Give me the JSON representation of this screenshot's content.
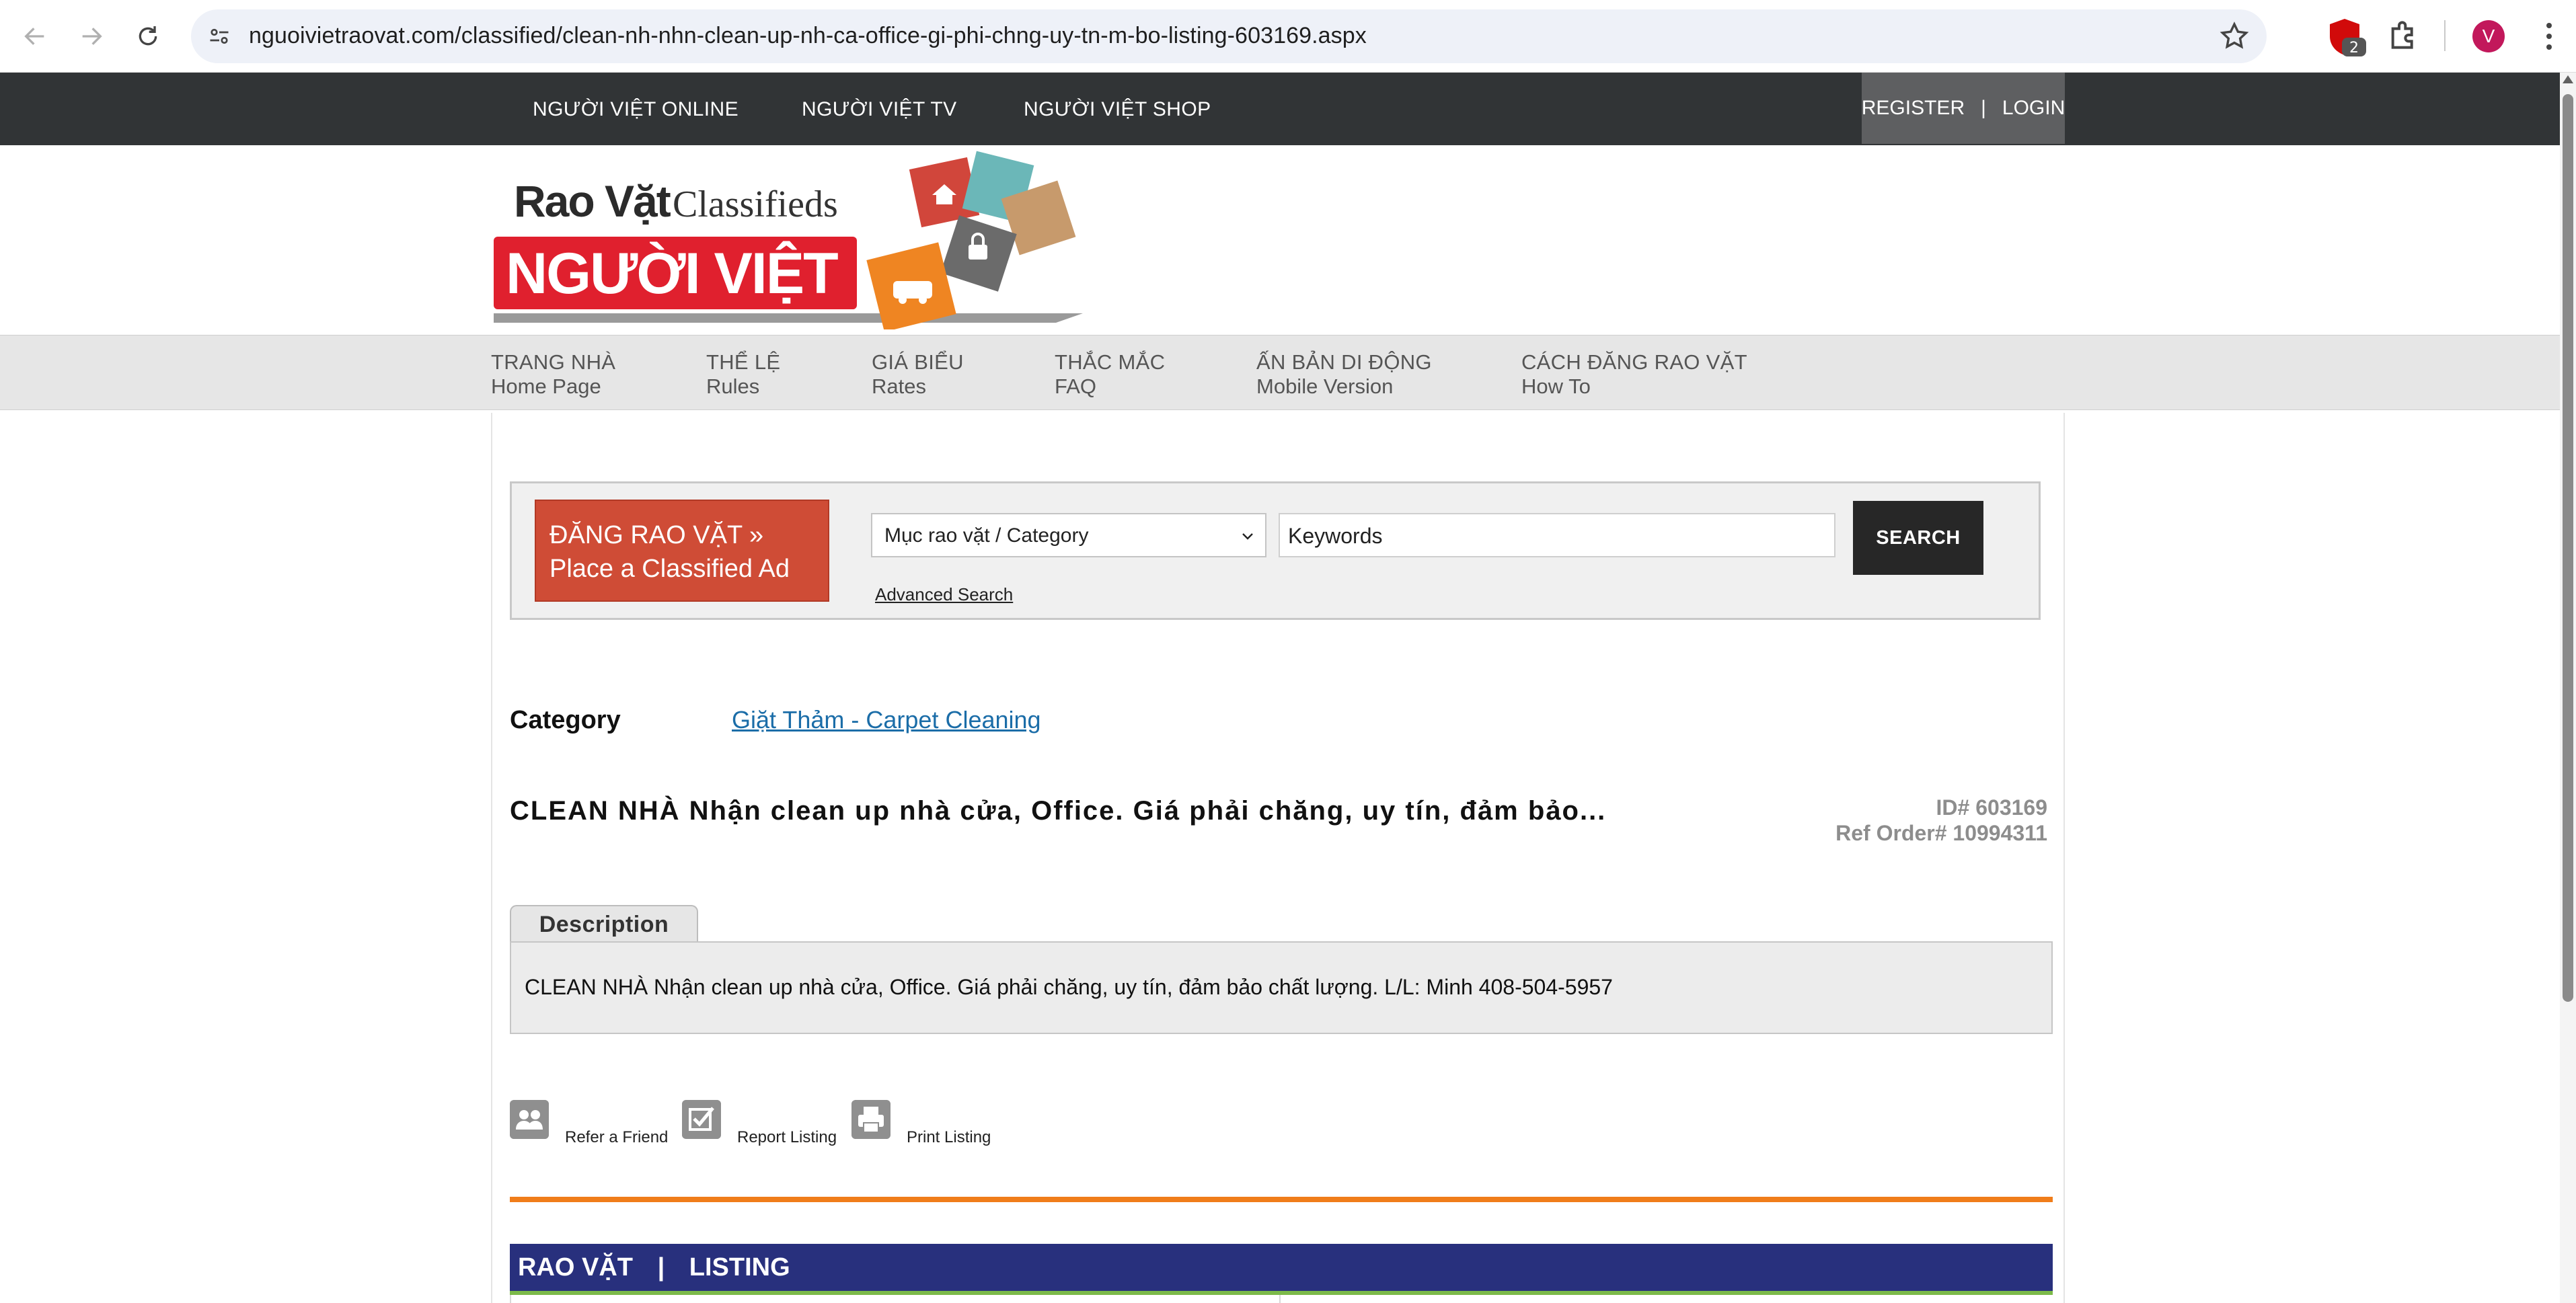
{
  "browser": {
    "url": "nguoivietraovat.com/classified/clean-nh-nhn-clean-up-nh-ca-office-gi-phi-chng-uy-tn-m-bo-listing-603169.aspx",
    "extension_badge": "2",
    "profile_initial": "V"
  },
  "topnav": {
    "links": [
      "NGƯỜI VIỆT ONLINE",
      "NGƯỜI VIỆT TV",
      "NGƯỜI VIỆT SHOP"
    ],
    "register": "REGISTER",
    "separator": "|",
    "login": "LOGIN"
  },
  "logo": {
    "line1_a": "Rao Vặt",
    "line1_b": "Classifieds",
    "line2": "NGƯỜI VIỆT"
  },
  "menu": [
    {
      "vn": "TRANG NHÀ",
      "en": "Home Page"
    },
    {
      "vn": "THỂ LỆ",
      "en": "Rules"
    },
    {
      "vn": "GIÁ BIỂU",
      "en": "Rates"
    },
    {
      "vn": "THẮC MẮC",
      "en": "FAQ"
    },
    {
      "vn": "ẤN BẢN DI ĐỘNG",
      "en": "Mobile Version"
    },
    {
      "vn": "CÁCH ĐĂNG RAO VẶT",
      "en": "How To"
    }
  ],
  "search": {
    "place_ad_line1": "ĐĂNG RAO VẶT »",
    "place_ad_line2": "Place a Classified Ad",
    "category_selected": "Mục rao vặt / Category",
    "keywords_value": "Keywords",
    "button": "SEARCH",
    "advanced": "Advanced Search"
  },
  "listing": {
    "category_label": "Category",
    "category_value": "Giặt Thảm - Carpet Cleaning",
    "title": "CLEAN NHÀ Nhận clean up nhà cửa, Office. Giá phải chăng, uy tín, đảm bảo...",
    "id": "ID# 603169",
    "ref_order": "Ref Order# 10994311",
    "description_tab": "Description",
    "description": "CLEAN NHÀ Nhận clean up nhà cửa, Office. Giá phải chăng, uy tín, đảm bảo chất lượng. L/L: Minh 408-504-5957"
  },
  "actions": [
    {
      "label": "Refer a Friend",
      "icon": "refer-friend-icon"
    },
    {
      "label": "Report Listing",
      "icon": "report-checkbox-icon"
    },
    {
      "label": "Print Listing",
      "icon": "printer-icon"
    }
  ],
  "footer_bar": {
    "left": "RAO VẶT",
    "separator": "|",
    "right": "LISTING"
  },
  "colors": {
    "topbar": "#313436",
    "place_ad": "#cf4c36",
    "orange_rule": "#f07d1a",
    "navy_bar": "#28307d",
    "green_rule": "#7cba4a",
    "link": "#1b6da8"
  }
}
